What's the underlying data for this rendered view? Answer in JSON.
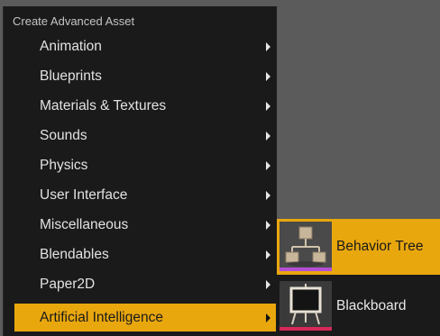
{
  "menu": {
    "header": "Create Advanced Asset",
    "items": [
      {
        "label": "Animation"
      },
      {
        "label": "Blueprints"
      },
      {
        "label": "Materials & Textures"
      },
      {
        "label": "Sounds"
      },
      {
        "label": "Physics"
      },
      {
        "label": "User Interface"
      },
      {
        "label": "Miscellaneous"
      },
      {
        "label": "Blendables"
      },
      {
        "label": "Paper2D"
      },
      {
        "label": "Artificial Intelligence",
        "active": true
      }
    ]
  },
  "submenu": {
    "items": [
      {
        "label": "Behavior Tree",
        "icon": "behavior-tree-icon",
        "accent": "#b34fd6",
        "active": true
      },
      {
        "label": "Blackboard",
        "icon": "blackboard-icon",
        "accent": "#d6285a",
        "active": false
      }
    ]
  },
  "colors": {
    "highlight": "#e9a70e",
    "menu_background": "#1a1a1a",
    "backdrop": "#5b5b5b"
  }
}
